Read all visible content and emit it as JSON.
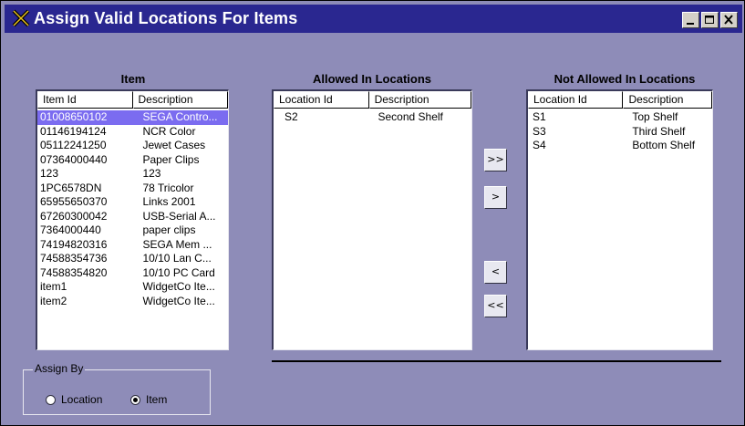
{
  "window": {
    "title": "Assign Valid Locations For Items",
    "controls": {
      "minimize": "minimize-icon",
      "maximize": "maximize-icon",
      "close": "close-icon"
    }
  },
  "item_panel": {
    "label": "Item",
    "columns": [
      "Item Id",
      "Description"
    ],
    "rows": [
      {
        "id": "01008650102",
        "desc": "SEGA Contro...",
        "selected": true
      },
      {
        "id": "01146194124",
        "desc": "NCR Color"
      },
      {
        "id": "05112241250",
        "desc": "Jewet Cases"
      },
      {
        "id": "07364000440",
        "desc": "Paper Clips"
      },
      {
        "id": "123",
        "desc": "123"
      },
      {
        "id": "1PC6578DN",
        "desc": "78 Tricolor"
      },
      {
        "id": "65955650370",
        "desc": "Links  2001"
      },
      {
        "id": "67260300042",
        "desc": "USB-Serial A..."
      },
      {
        "id": "7364000440",
        "desc": "paper clips"
      },
      {
        "id": "74194820316",
        "desc": "SEGA Mem ..."
      },
      {
        "id": "74588354736",
        "desc": "10/10 Lan C..."
      },
      {
        "id": "74588354820",
        "desc": "10/10 PC Card"
      },
      {
        "id": "item1",
        "desc": "WidgetCo Ite..."
      },
      {
        "id": "item2",
        "desc": "WidgetCo Ite..."
      }
    ]
  },
  "allowed_panel": {
    "label": "Allowed In Locations",
    "columns": [
      "Location Id",
      "Description"
    ],
    "rows": [
      {
        "id": "S2",
        "desc": "Second Shelf"
      }
    ]
  },
  "not_allowed_panel": {
    "label": "Not Allowed In Locations",
    "columns": [
      "Location Id",
      "Description"
    ],
    "rows": [
      {
        "id": "S1",
        "desc": "Top Shelf"
      },
      {
        "id": "S3",
        "desc": "Third Shelf"
      },
      {
        "id": "S4",
        "desc": "Bottom Shelf"
      }
    ]
  },
  "move_buttons": {
    "all_right": ">>",
    "one_right": ">",
    "one_left": "<",
    "all_left": "<<"
  },
  "assign_by": {
    "legend": "Assign By",
    "options": [
      {
        "label": "Location",
        "checked": false
      },
      {
        "label": "Item",
        "checked": true
      }
    ]
  },
  "colors": {
    "window_bg": "#8e8cb8",
    "titlebar": "#2a2790",
    "selection": "#7b6cf0"
  }
}
